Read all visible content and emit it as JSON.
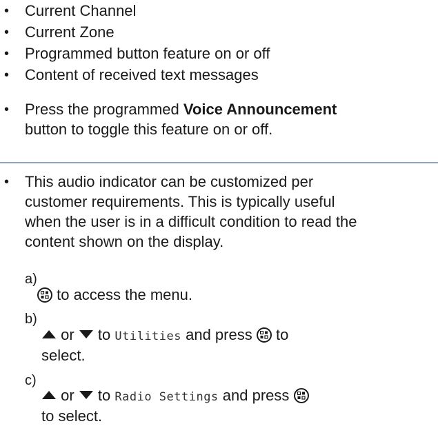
{
  "list1": {
    "items": [
      "Current Channel",
      "Current Zone",
      "Programmed button feature on or off",
      "Content of received text messages"
    ]
  },
  "press": {
    "prefix": "Press the programmed ",
    "bold": "Voice Announcement",
    "line2": "button to toggle this feature on or off."
  },
  "note": {
    "lines": [
      "This audio indicator can be customized per",
      "customer requirements. This is typically useful",
      "when the user is in a difficult condition to read the",
      "content shown on the display."
    ]
  },
  "steps": {
    "a": {
      "label": "a)",
      "text": " to access the menu."
    },
    "b": {
      "label": "b)",
      "or": " or ",
      "to": " to ",
      "target": "Utilities",
      "press": " and press ",
      "tail": " to",
      "line2": "select."
    },
    "c": {
      "label": "c)",
      "or": " or ",
      "to": " to ",
      "target": "Radio Settings",
      "press": " and press ",
      "line2": "to select."
    }
  },
  "icons": {
    "menu": "menu-ok-icon",
    "up": "up-arrow-icon",
    "down": "down-arrow-icon"
  },
  "colors": {
    "divider": "#8aa6c4"
  }
}
